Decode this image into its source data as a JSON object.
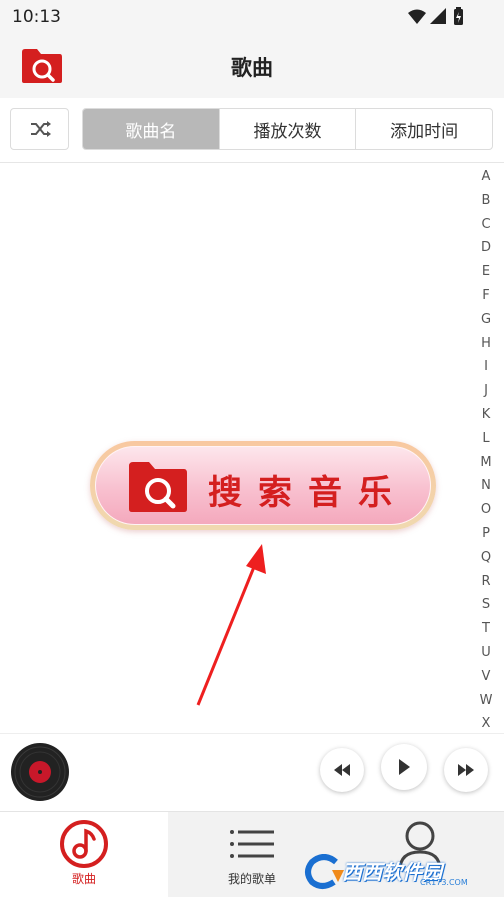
{
  "status": {
    "time": "10:13",
    "icons": [
      "wifi-icon",
      "signal-icon",
      "battery-charging-icon"
    ]
  },
  "header": {
    "title": "歌曲",
    "logo_icon": "search-folder-icon"
  },
  "sortbar": {
    "shuffle_icon": "shuffle-icon",
    "segments": [
      {
        "label": "歌曲名",
        "active": true
      },
      {
        "label": "播放次数",
        "active": false
      },
      {
        "label": "添加时间",
        "active": false
      }
    ]
  },
  "alpha_index": [
    "A",
    "B",
    "C",
    "D",
    "E",
    "F",
    "G",
    "H",
    "I",
    "J",
    "K",
    "L",
    "M",
    "N",
    "O",
    "P",
    "Q",
    "R",
    "S",
    "T",
    "U",
    "V",
    "W",
    "X"
  ],
  "search_music": {
    "label": "搜索音乐",
    "icon": "search-folder-icon"
  },
  "player": {
    "controls": [
      "rewind-icon",
      "play-icon",
      "fast-forward-icon"
    ]
  },
  "bottom_nav": {
    "items": [
      {
        "label": "歌曲",
        "icon": "music-note-icon",
        "active": true
      },
      {
        "label": "我的歌单",
        "icon": "list-icon",
        "active": false
      },
      {
        "label": "",
        "icon": "user-icon",
        "active": false
      }
    ]
  },
  "watermark": {
    "brand": "西西软件园",
    "sub": "CR173.COM"
  },
  "colors": {
    "accent": "#d41f1f",
    "segment_active": "#b8b8b8",
    "header_bg": "#f5f5f5"
  }
}
